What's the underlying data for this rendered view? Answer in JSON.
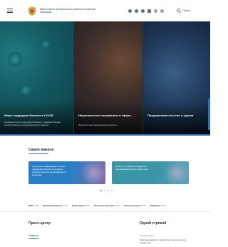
{
  "header": {
    "ministry_name": "Министерство экономического развития Российской Федерации",
    "search_label": "Поиск",
    "icons": [
      "vk-icon",
      "telegram-icon",
      "ok-icon",
      "youtube-icon",
      "accessibility-icon",
      "language-icon"
    ]
  },
  "hero": {
    "slides": [
      {
        "title": "Меры поддержки бизнеса в COVID",
        "text": "Основные меры поддержки бизнеса и граждан в период распространения коронавирусной инфекции"
      },
      {
        "title": "Национальные инициативы в сфере...",
        "text": "Приоритетные национальные проекты"
      },
      {
        "title": "Предпринимательство и туризм",
        "text": ""
      }
    ]
  },
  "news": {
    "title": "Самое важное",
    "cards": [
      {
        "text": "Актуальная информация о мерах поддержки бизнеса в условиях распространения коронавирусной инфекции"
      },
      {
        "text": "Новости о мерах по поддержке предпринимателей и инвесторов"
      }
    ],
    "dots": 4,
    "active_dot": 0
  },
  "ticker": [
    {
      "label": "ВВП",
      "value": "1.3 %"
    },
    {
      "label": "Промпроизводство",
      "value": "0.7 %"
    },
    {
      "label": "Инвестиции",
      "value": "0.8 %"
    },
    {
      "label": "Розничная торговля",
      "value": "1.1 %"
    },
    {
      "label": "Платные услуги",
      "value": "0.9 %"
    },
    {
      "label": "Инфляция",
      "value": "3.9 %"
    }
  ],
  "press": {
    "title": "Пресс-центр",
    "tab": "Новости"
  },
  "hotline": {
    "title": "Одной строкой",
    "subtitle": "4 апреля 2021",
    "text": "Минэкономразвития: разработан подход к расчету показателей"
  },
  "colors": {
    "accent": "#2d6ec7",
    "card_blue": "#2a7fc4",
    "card_teal": "#3a95a6"
  }
}
